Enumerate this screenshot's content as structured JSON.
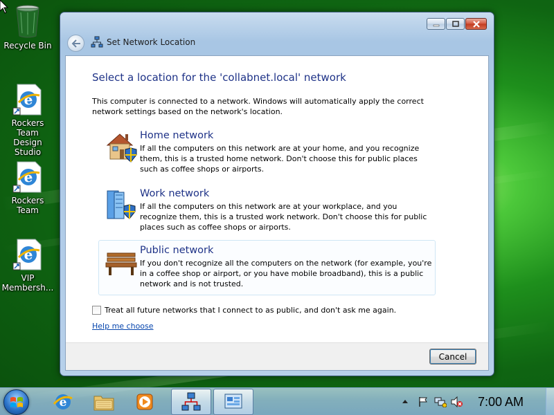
{
  "desktop": {
    "icons": [
      {
        "label": "Recycle Bin",
        "icon": "recycle-bin-icon"
      },
      {
        "label": "Rockers Team\nDesign Studio",
        "icon": "internet-explorer-icon"
      },
      {
        "label": "Rockers Team",
        "icon": "internet-explorer-icon"
      },
      {
        "label": "VIP\nMembersh...",
        "icon": "internet-explorer-icon"
      }
    ]
  },
  "window": {
    "title": "Set Network Location",
    "heading": "Select a location for the 'collabnet.local' network",
    "intro": "This computer is connected to a network. Windows will automatically apply the correct network settings based on the network's location.",
    "options": [
      {
        "title": "Home network",
        "description": "If all the computers on this network are at your home, and you recognize them, this is a trusted home network.  Don't choose this for public places such as coffee shops or airports.",
        "icon": "home-network-icon"
      },
      {
        "title": "Work network",
        "description": "If all the computers on this network are at your workplace, and you recognize them, this is a trusted work network.  Don't choose this for public places such as coffee shops or airports.",
        "icon": "work-network-icon"
      },
      {
        "title": "Public network",
        "description": "If you don't recognize all the computers on the network (for example, you're in a coffee shop or airport, or you have mobile broadband), this is a public network and is not trusted.",
        "icon": "public-network-icon"
      }
    ],
    "checkbox_label": "Treat all future networks that I connect to as public, and don't ask me again.",
    "checkbox_checked": false,
    "help_link": "Help me choose",
    "cancel_label": "Cancel"
  },
  "taskbar": {
    "pinned": [
      "internet-explorer-icon",
      "windows-explorer-icon",
      "media-player-icon"
    ],
    "running": [
      "network-icon",
      "control-panel-icon"
    ],
    "tray_icons": [
      "show-hidden-icons-icon",
      "action-center-flag-icon",
      "network-tray-icon",
      "volume-muted-icon"
    ],
    "clock": "7:00 AM"
  },
  "colors": {
    "heading": "#1e3287",
    "link": "#0645ad",
    "desktop_green": "#1e8f1c"
  }
}
